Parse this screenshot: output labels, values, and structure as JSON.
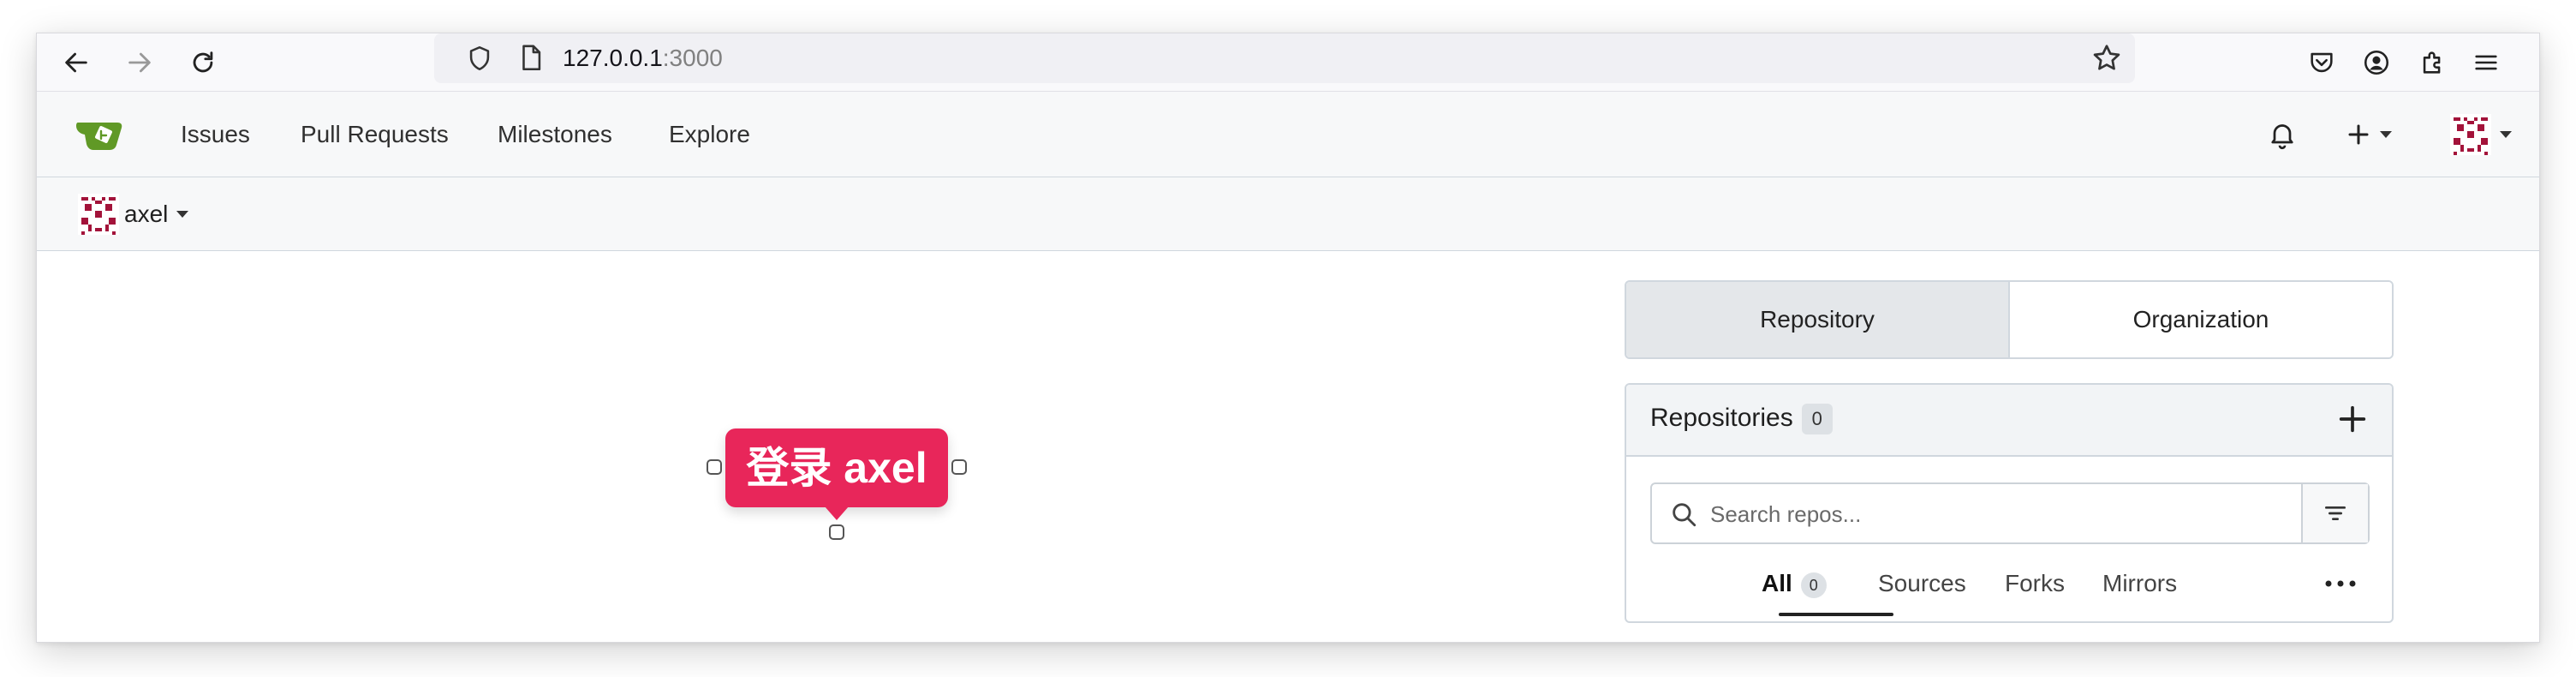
{
  "browser": {
    "url_host": "127.0.0.1",
    "url_port": ":3000"
  },
  "nav": {
    "items": [
      "Issues",
      "Pull Requests",
      "Milestones",
      "Explore"
    ]
  },
  "context": {
    "username": "axel"
  },
  "annotation": {
    "text": "登录 axel"
  },
  "switcher": {
    "repository": "Repository",
    "organization": "Organization"
  },
  "repos": {
    "title": "Repositories",
    "count": "0",
    "search_placeholder": "Search repos...",
    "filters": {
      "all": "All",
      "all_count": "0",
      "sources": "Sources",
      "forks": "Forks",
      "mirrors": "Mirrors"
    }
  },
  "colors": {
    "accent": "#e8265a",
    "gitea_green": "#609926",
    "avatar": "#a3133a"
  }
}
